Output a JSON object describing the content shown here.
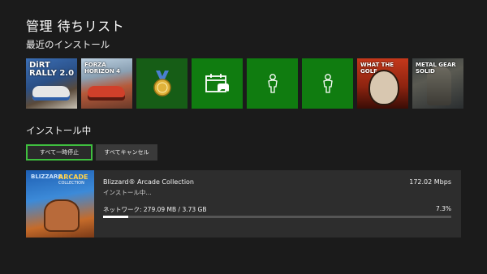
{
  "header": {
    "title": "管理  待ちリスト"
  },
  "recent": {
    "label": "最近のインストール",
    "tiles": [
      {
        "kind": "game-art",
        "art_text": "DiRT RALLY 2.0"
      },
      {
        "kind": "game-art",
        "art_text": "FORZA HORIZON 4"
      },
      {
        "kind": "icon",
        "icon": "achievement-medal-icon"
      },
      {
        "kind": "icon",
        "icon": "calendar-controller-icon"
      },
      {
        "kind": "icon",
        "icon": "avatar-icon"
      },
      {
        "kind": "icon",
        "icon": "avatar-icon"
      },
      {
        "kind": "game-art",
        "art_text": "WHAT THE GOLF"
      },
      {
        "kind": "game-art",
        "art_text": "METAL GEAR SOLID"
      }
    ]
  },
  "installing": {
    "label": "インストール中",
    "pause_all_label": "すべて一時停止",
    "cancel_all_label": "すべてキャンセル",
    "item": {
      "title": "Blizzard® Arcade Collection",
      "status": "インストール中...",
      "speed": "172.02 Mbps",
      "network": "ネットワーク: 279.09 MB / 3.73 GB",
      "percent": "7.3%",
      "progress": 0.073,
      "art_logo_left": "BLIZZARD",
      "art_logo_right": "ARCADE",
      "art_logo_sub": "COLLECTION"
    }
  },
  "colors": {
    "background": "#1b1b1b",
    "xbox_green": "#107c10",
    "focus_outline": "#3fbf3f",
    "row_background": "#2d2d2d"
  }
}
